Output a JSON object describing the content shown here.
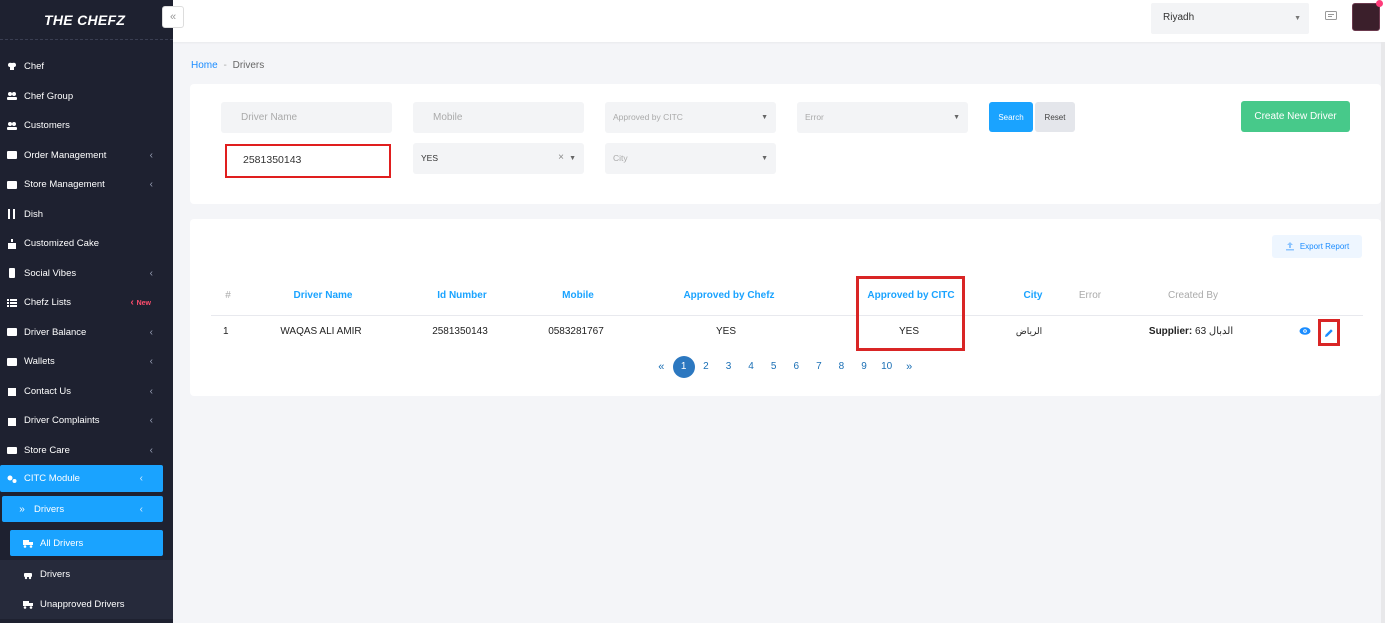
{
  "brand": "THE CHEFZ",
  "collapse_icon": "«",
  "sidebar": {
    "items": [
      {
        "label": "Chef",
        "icon": "hat-icon"
      },
      {
        "label": "Chef Group",
        "icon": "group-icon"
      },
      {
        "label": "Customers",
        "icon": "users-icon"
      },
      {
        "label": "Order Management",
        "icon": "list-icon",
        "chevron": true
      },
      {
        "label": "Store Management",
        "icon": "list-icon",
        "chevron": true
      },
      {
        "label": "Dish",
        "icon": "cutlery-icon"
      },
      {
        "label": "Customized Cake",
        "icon": "cake-icon"
      },
      {
        "label": "Social Vibes",
        "icon": "phone-icon",
        "chevron": true
      },
      {
        "label": "Chefz Lists",
        "icon": "bullet-list-icon",
        "badge": "New"
      },
      {
        "label": "Driver Balance",
        "icon": "wallet-icon",
        "chevron": true
      },
      {
        "label": "Wallets",
        "icon": "wallet-icon",
        "chevron": true
      },
      {
        "label": "Contact Us",
        "icon": "building-icon",
        "chevron": true
      },
      {
        "label": "Driver Complaints",
        "icon": "building-icon",
        "chevron": true
      },
      {
        "label": "Store Care",
        "icon": "store-icon",
        "chevron": true
      }
    ],
    "citc_module": "CITC Module",
    "drivers_group": "Drivers",
    "all_drivers": "All Drivers",
    "drivers": "Drivers",
    "unapproved_drivers": "Unapproved Drivers"
  },
  "topbar": {
    "city": "Riyadh"
  },
  "breadcrumb": {
    "home": "Home",
    "separator": "-",
    "current": "Drivers"
  },
  "filters": {
    "driver_name_placeholder": "Driver Name",
    "mobile_placeholder": "Mobile",
    "approved_citc_placeholder": "Approved by CITC",
    "error_placeholder": "Error",
    "id_number_value": "2581350143",
    "approved_chefz_value": "YES",
    "city_placeholder": "City",
    "search_label": "Search",
    "reset_label": "Reset",
    "create_label": "Create New Driver"
  },
  "table": {
    "export_label": "Export Report",
    "headers": [
      "#",
      "Driver Name",
      "Id Number",
      "Mobile",
      "Approved by Chefz",
      "Approved by CITC",
      "City",
      "Error",
      "Created By"
    ],
    "row": {
      "index": "1",
      "driver_name": "WAQAS ALI AMIR",
      "id_number": "2581350143",
      "mobile": "0583281767",
      "approved_chefz": "YES",
      "approved_citc": "YES",
      "city": "الرياض",
      "error": "",
      "created_by_label": "Supplier:",
      "created_by_value": "63 الدبال"
    }
  },
  "pagination": {
    "prev": "«",
    "pages": [
      "1",
      "2",
      "3",
      "4",
      "5",
      "6",
      "7",
      "8",
      "9",
      "10"
    ],
    "active": "1",
    "next": "»"
  },
  "colors": {
    "sidebar_bg": "#1e2130",
    "accent": "#1aa3ff",
    "create_button": "#47c98a",
    "highlight_box": "#d92525"
  }
}
